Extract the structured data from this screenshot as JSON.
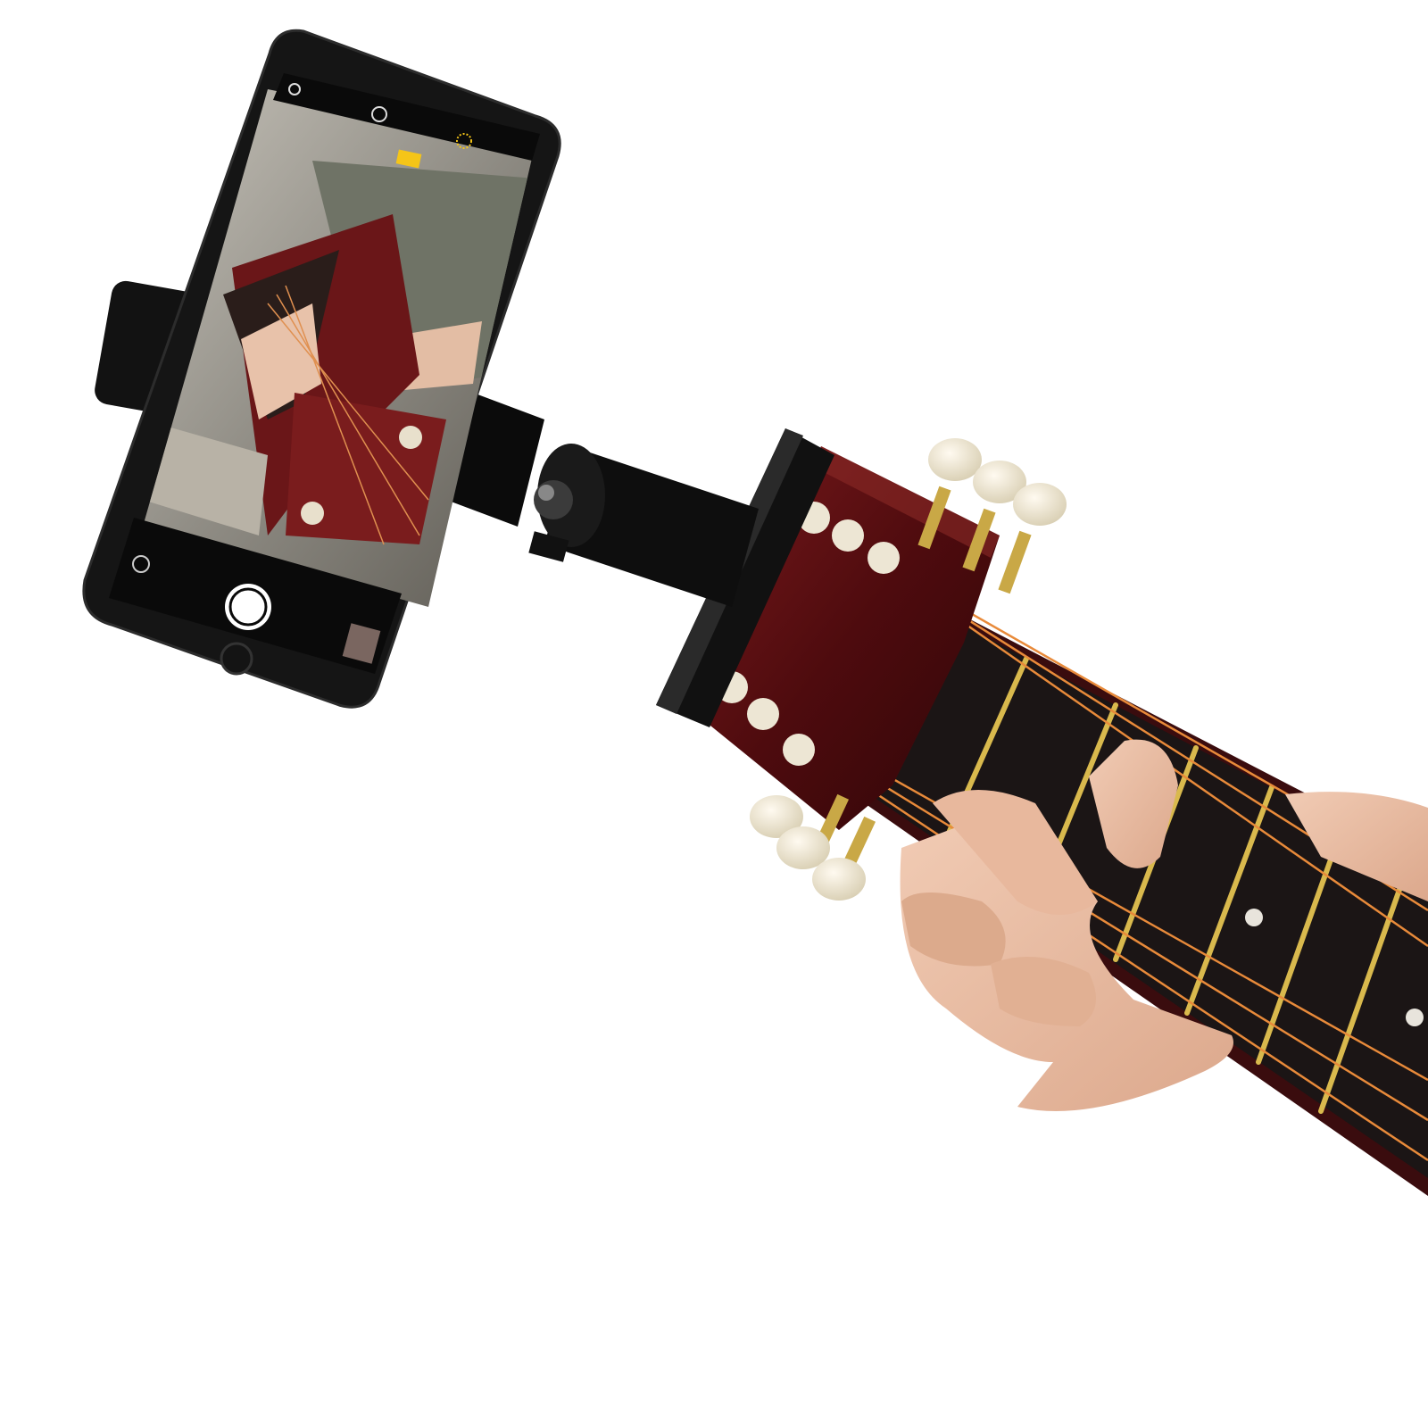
{
  "scene": {
    "subject": "smartphone-mounted-on-guitar-headstock",
    "background_color": "#ffffff"
  },
  "phone": {
    "body_color": "#111111",
    "screen_mode": "camera-viewfinder",
    "icons": [
      "flash-icon",
      "live-photo-icon",
      "filter-icon",
      "flip-camera-icon",
      "shutter-button-icon",
      "photo-thumbnail-icon",
      "home-button-icon"
    ],
    "accent_color": "#f5c518"
  },
  "guitar": {
    "wood_color": "#5a0f12",
    "fretboard_color": "#1a1414",
    "string_color": "#e8873a",
    "fret_color": "#d8b84a",
    "tuner_button_color": "#efe9d6"
  },
  "mount": {
    "color": "#0d0d0d"
  }
}
